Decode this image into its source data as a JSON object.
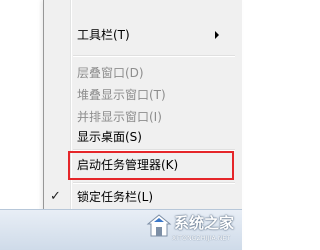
{
  "context_menu": {
    "items": [
      {
        "label": "工具栏(T)",
        "enabled": true,
        "submenu": true
      },
      {
        "label": "层叠窗口(D)",
        "enabled": false
      },
      {
        "label": "堆叠显示窗口(T)",
        "enabled": false
      },
      {
        "label": "并排显示窗口(I)",
        "enabled": false
      },
      {
        "label": "显示桌面(S)",
        "enabled": true
      },
      {
        "label": "启动任务管理器(K)",
        "enabled": true,
        "highlighted": true
      },
      {
        "label": "锁定任务栏(L)",
        "enabled": true,
        "checked": true
      }
    ],
    "check_glyph": "✓"
  },
  "watermark": {
    "text": "系统之家",
    "url": "XITONGZHIJIA.NET"
  },
  "colors": {
    "highlight_border": "#e5262a",
    "disabled_text": "#8d8d8d"
  }
}
